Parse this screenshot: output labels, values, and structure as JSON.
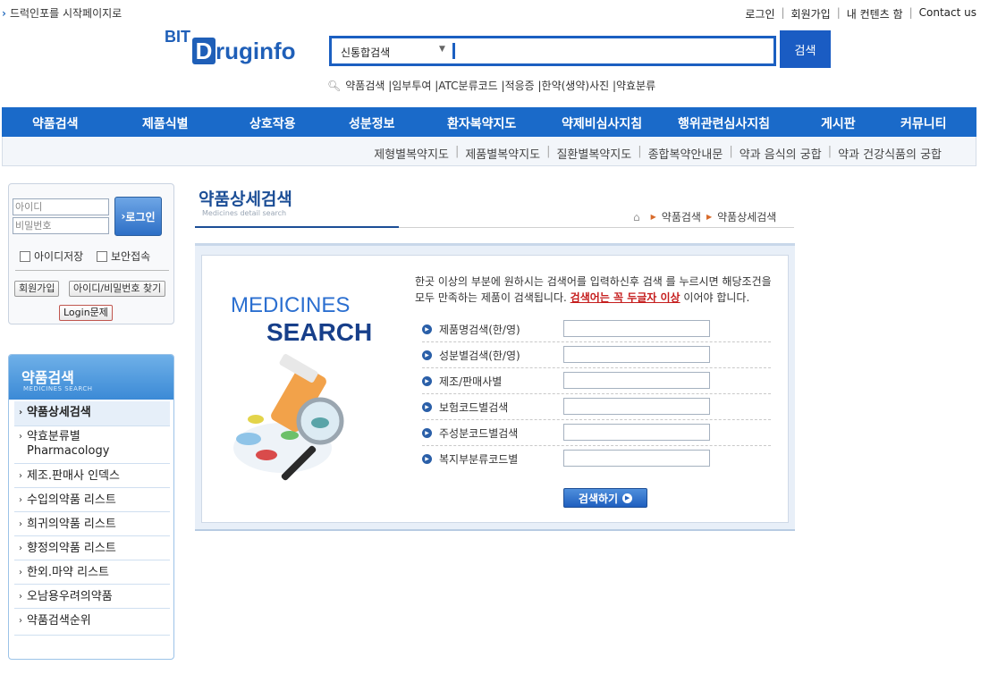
{
  "topbar": {
    "home_link": "드럭인포를 시작페이지로",
    "util_links": [
      "로그인",
      "회원가입",
      "내 컨텐츠 함",
      "Contact us"
    ]
  },
  "logo": {
    "bit": "BIT",
    "d": "D",
    "rest": "ruginfo"
  },
  "search": {
    "select_value": "신통합검색",
    "button_label": "검색",
    "quick_links": "약품검색 |임부투여 |ATC분류코드 |적응증 |한약(생약)사진 |약효분류"
  },
  "main_nav": [
    "약품검색",
    "제품식별",
    "상호작용",
    "성분정보",
    "환자복약지도",
    "약제비심사지침",
    "행위관련심사지침",
    "게시판",
    "커뮤니티"
  ],
  "sub_nav": [
    "제형별복약지도",
    "제품별복약지도",
    "질환별복약지도",
    "종합복약안내문",
    "약과 음식의 궁합",
    "약과 건강식품의 궁합"
  ],
  "login": {
    "id_placeholder": "아이디",
    "pw_placeholder": "비밀번호",
    "login_button": "로그인",
    "save_id": "아이디저장",
    "secure_login": "보안접속",
    "join_button": "회원가입",
    "find_button": "아이디/비밀번호 찾기",
    "problem_button": "Login문제"
  },
  "left_menu": {
    "title": "약품검색",
    "subtitle": "MEDICINES SEARCH",
    "items": [
      "약품상세검색",
      "약효분류별",
      "Pharmacology",
      "제조.판매사 인덱스",
      "수입의약품 리스트",
      "희귀의약품 리스트",
      "향정의약품 리스트",
      "한외.마약 리스트",
      "오남용우려의약품",
      "약품검색순위"
    ]
  },
  "content": {
    "title": "약품상세검색",
    "title_en": "Medicines detail search",
    "breadcrumb": [
      "약품검색",
      "약품상세검색"
    ],
    "panel_line1": "MEDICINES",
    "panel_line2": "SEARCH",
    "desc_1": "한곳 이상의 부분에 원하시는 검색어를 입력하신후 검색 를 누르시면 해당조건을 모두 만족하는 제품이 검색됩니다.",
    "desc_emph": "검색어는 꼭 두글자 이상",
    "desc_2": "이어야 합니다.",
    "fields": [
      "제품명검색(한/영)",
      "성분별검색(한/영)",
      "제조/판매사별",
      "보험코드별검색",
      "주성분코드별검색",
      "복지부분류코드별"
    ],
    "submit": "검색하기"
  }
}
